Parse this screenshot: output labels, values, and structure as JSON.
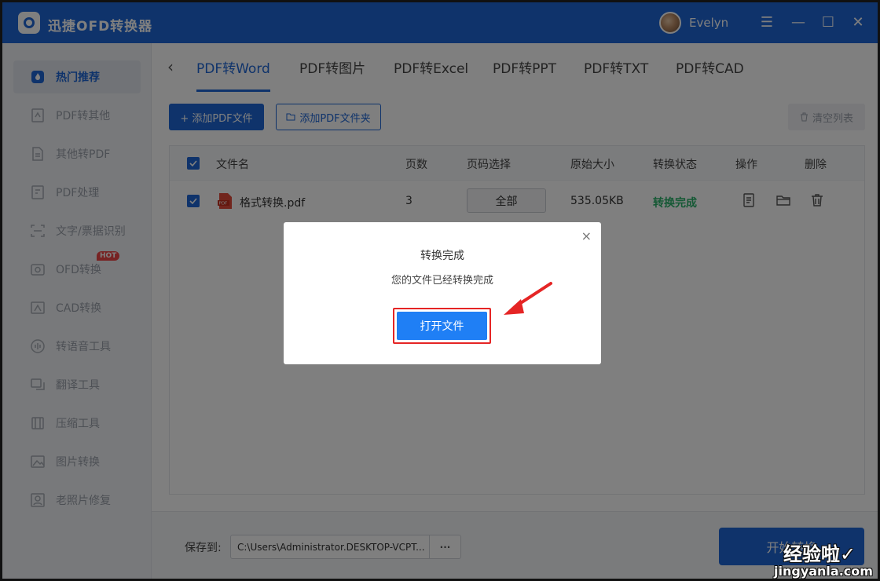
{
  "app": {
    "title": "迅捷OFD转换器",
    "user_name": "Evelyn",
    "brand_color": "#1f67d6"
  },
  "window_controls": {
    "menu": "☰",
    "minimize": "—",
    "maximize": "☐",
    "close": "✕"
  },
  "sidebar": {
    "items": [
      {
        "label": "热门推荐",
        "icon": "flame-icon",
        "active": true
      },
      {
        "label": "PDF转其他",
        "icon": "pdf-export-icon"
      },
      {
        "label": "其他转PDF",
        "icon": "file-to-pdf-icon"
      },
      {
        "label": "PDF处理",
        "icon": "pdf-edit-icon"
      },
      {
        "label": "文字/票据识别",
        "icon": "ocr-scan-icon"
      },
      {
        "label": "OFD转换",
        "icon": "ofd-icon",
        "badge": "HOT"
      },
      {
        "label": "CAD转换",
        "icon": "cad-icon"
      },
      {
        "label": "转语音工具",
        "icon": "voice-icon"
      },
      {
        "label": "翻译工具",
        "icon": "translate-icon"
      },
      {
        "label": "压缩工具",
        "icon": "compress-icon"
      },
      {
        "label": "图片转换",
        "icon": "image-icon"
      },
      {
        "label": "老照片修复",
        "icon": "photo-repair-icon"
      }
    ]
  },
  "tabs": [
    {
      "label": "PDF转Word",
      "active": true
    },
    {
      "label": "PDF转图片"
    },
    {
      "label": "PDF转Excel"
    },
    {
      "label": "PDF转PPT"
    },
    {
      "label": "PDF转TXT"
    },
    {
      "label": "PDF转CAD"
    }
  ],
  "toolbar": {
    "add_file": "+ 添加PDF文件",
    "add_folder": "添加PDF文件夹",
    "clear_list": "清空列表"
  },
  "table": {
    "headers": [
      "文件名",
      "页数",
      "页码选择",
      "原始大小",
      "转换状态",
      "操作",
      "删除"
    ],
    "rows": [
      {
        "file_name": "格式转换.pdf",
        "pages": "3",
        "page_select": "全部",
        "size": "535.05KB",
        "status": "转换完成",
        "status_color": "#2bb26b"
      }
    ]
  },
  "footer": {
    "save_label": "保存到:",
    "save_path": "C:\\Users\\Administrator.DESKTOP-VCPT...",
    "more": "···",
    "start_button": "开始转换"
  },
  "dialog": {
    "title": "转换完成",
    "message": "您的文件已经转换完成",
    "open_button": "打开文件",
    "close": "×",
    "highlight_color": "#e52525"
  },
  "watermark": {
    "line1": "经验啦✓",
    "line2": "jingyanla.com"
  }
}
